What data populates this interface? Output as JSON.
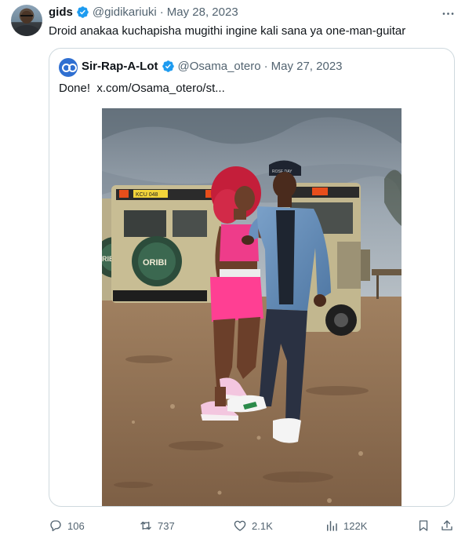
{
  "tweet": {
    "author_name": "gids",
    "author_handle": "@gidikariuki",
    "separator": "·",
    "date": "May 28, 2023",
    "text": "Droid anakaa kuchapisha mugithi ingine kali sana ya one-man-guitar"
  },
  "quoted": {
    "author_name": "Sir-Rap-A-Lot",
    "author_handle": "@Osama_otero",
    "separator": "·",
    "date": "May 27, 2023",
    "text": "Done!",
    "link": "x.com/Osama_otero/st...",
    "photo": {
      "vehicle_plate_text": "KCU 048",
      "vehicle_tire_text": "ORIBI",
      "vehicle_tire_text_2": "RIBI",
      "cap_text": "ROSE DAY"
    }
  },
  "actions": {
    "replies": "106",
    "retweets": "737",
    "likes": "2.1K",
    "views": "122K"
  },
  "colors": {
    "verified": "#1d9bf0",
    "text_primary": "#0f1419",
    "text_secondary": "#536471",
    "border": "#cfd9de"
  },
  "icons": [
    "more-icon",
    "verified-icon",
    "reply-icon",
    "retweet-icon",
    "like-icon",
    "views-icon",
    "bookmark-icon",
    "share-icon"
  ]
}
